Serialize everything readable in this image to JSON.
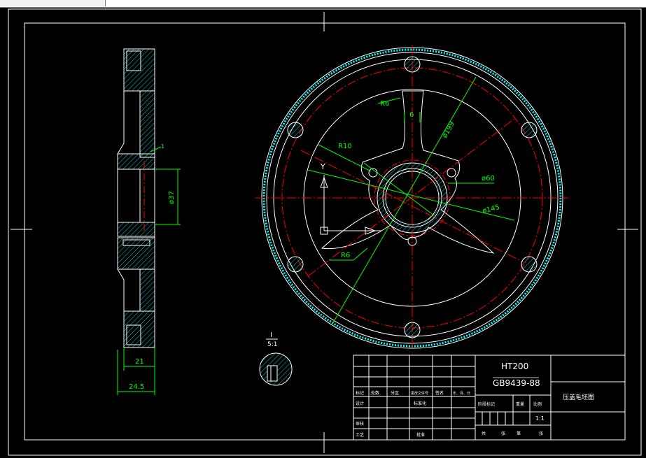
{
  "material": "HT200",
  "standard": "GB9439-88",
  "drawing_name": "压盖毛坯图",
  "scale": "1:1",
  "section_callout": {
    "id": "I",
    "scale_text": "5:1"
  },
  "dimensions": {
    "thickness_inner": "21",
    "thickness_outer": "24.5",
    "bore": "ø37",
    "circle_large": "ø199",
    "circle_hub": "ø60",
    "circle_holes": "ø145",
    "radius_r6_top": "R6",
    "radius_r10": "R10",
    "radius_r6_bottom": "R6",
    "spoke_width": "6",
    "leader_label": "1"
  },
  "axis_labels": {
    "y": "Y"
  },
  "title_block": {
    "row_labels": [
      "标记",
      "处数",
      "分区",
      "更改文件号",
      "签名",
      "年、月、日"
    ],
    "labels_left": [
      "设计",
      "审核",
      "工艺"
    ],
    "label_std": "标准化",
    "label_approve": "批准",
    "label_stage": "阶段标记",
    "label_weight": "重量",
    "label_ratio": "比例",
    "label_sheet": "共",
    "label_sheet2": "张",
    "label_page": "第",
    "label_page2": "张"
  },
  "colors": {
    "background": "#000000",
    "outline": "#ffffff",
    "dimension": "#00ff00",
    "centerline": "#ff0000",
    "hatch": "#00ffff"
  }
}
